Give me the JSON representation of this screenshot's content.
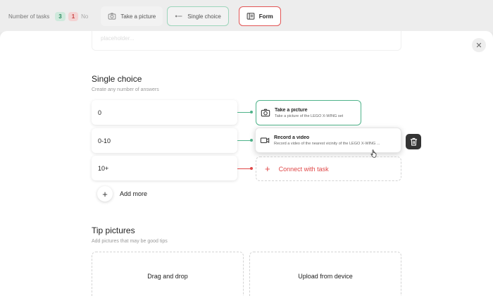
{
  "toolbar": {
    "tasks_label": "Number of tasks",
    "count_yes": "3",
    "count_no_num": "1",
    "count_no_label": "No",
    "chips": [
      {
        "label": "Take a picture",
        "icon": "camera-icon"
      },
      {
        "label": "Single choice",
        "icon": "single-choice-icon"
      },
      {
        "label": "Form",
        "icon": "form-icon"
      }
    ]
  },
  "faded_input": {
    "text": "placeholder..."
  },
  "single_choice": {
    "title": "Single choice",
    "subtitle": "Create any number of answers",
    "answers": [
      {
        "label": "0"
      },
      {
        "label": "0-10"
      },
      {
        "label": "10+"
      }
    ],
    "add_more": "Add more"
  },
  "tasks": [
    {
      "title": "Take a picture",
      "description": "Take a picture of the LEGO X-WING set",
      "icon": "camera-icon"
    },
    {
      "title": "Record a video",
      "description": "Record a video of the nearest vicinity of the LEGO X-WING ...",
      "icon": "video-icon"
    }
  ],
  "connect_task": {
    "label": "Connect with task"
  },
  "tip_pictures": {
    "title": "Tip pictures",
    "subtitle": "Add pictures that may be good tips",
    "drag_drop": "Drag and drop",
    "upload": "Upload from device"
  },
  "colors": {
    "accent_green": "#4fb38a",
    "accent_red": "#e04848"
  }
}
